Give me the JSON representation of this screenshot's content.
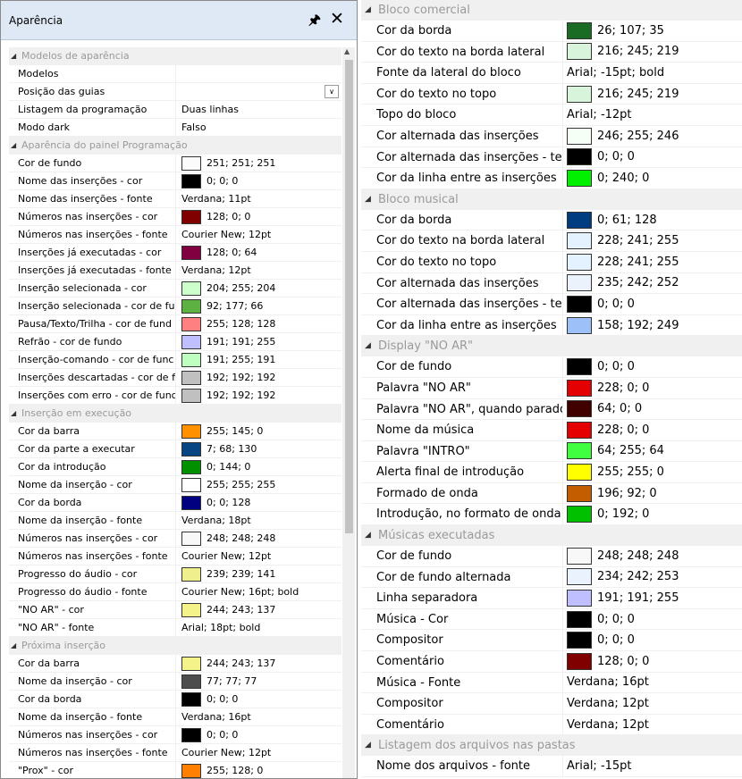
{
  "left_panel": {
    "title": "Aparência",
    "categories": [
      {
        "label": "Modelos de aparência",
        "rows": [
          {
            "name": "Modelos",
            "value": ""
          },
          {
            "name": "Posição das guias",
            "value": "",
            "dropdown": true
          },
          {
            "name": "Listagem da programação",
            "value": "Duas linhas"
          },
          {
            "name": "Modo dark",
            "value": "Falso"
          }
        ]
      },
      {
        "label": "Aparência do painel Programação",
        "rows": [
          {
            "name": "Cor de fundo",
            "color": "#fbfbfb",
            "value": "251; 251; 251"
          },
          {
            "name": "Nome das inserções - cor",
            "color": "#000000",
            "value": "0; 0; 0"
          },
          {
            "name": "Nome das inserções - fonte",
            "value": "Verdana; 11pt"
          },
          {
            "name": "Números nas inserções - cor",
            "color": "#800000",
            "value": "128; 0; 0"
          },
          {
            "name": "Números nas inserções - fonte",
            "value": "Courier New; 12pt"
          },
          {
            "name": "Inserções já executadas - cor",
            "color": "#800040",
            "value": "128; 0; 64"
          },
          {
            "name": "Inserções já executadas - fonte",
            "value": "Verdana; 12pt"
          },
          {
            "name": "Inserção selecionada - cor",
            "color": "#ccffcc",
            "value": "204; 255; 204"
          },
          {
            "name": "Inserção selecionada - cor de fur",
            "color": "#5cb142",
            "value": "92; 177; 66"
          },
          {
            "name": "Pausa/Texto/Trilha - cor de fund",
            "color": "#ff8080",
            "value": "255; 128; 128"
          },
          {
            "name": "Refrão - cor de fundo",
            "color": "#bfbfff",
            "value": "191; 191; 255"
          },
          {
            "name": "Inserção-comando - cor de func",
            "color": "#bfffbf",
            "value": "191; 255; 191"
          },
          {
            "name": "Inserções descartadas - cor de fu",
            "color": "#c0c0c0",
            "value": "192; 192; 192"
          },
          {
            "name": "Inserções com erro - cor de func",
            "color": "#c0c0c0",
            "value": "192; 192; 192"
          }
        ]
      },
      {
        "label": "Inserção em execução",
        "rows": [
          {
            "name": "Cor da barra",
            "color": "#ff9100",
            "value": "255; 145; 0"
          },
          {
            "name": "Cor da parte a executar",
            "color": "#074482",
            "value": "7; 68; 130"
          },
          {
            "name": "Cor da introdução",
            "color": "#009000",
            "value": "0; 144; 0"
          },
          {
            "name": "Nome da inserção - cor",
            "color": "#ffffff",
            "value": "255; 255; 255"
          },
          {
            "name": "Cor da borda",
            "color": "#000080",
            "value": "0; 0; 128"
          },
          {
            "name": "Nome da inserção - fonte",
            "value": "Verdana; 18pt"
          },
          {
            "name": "Números nas inserções - cor",
            "color": "#f8f8f8",
            "value": "248; 248; 248"
          },
          {
            "name": "Números nas inserções - fonte",
            "value": "Courier New; 12pt"
          },
          {
            "name": "Progresso do áudio - cor",
            "color": "#efef8d",
            "value": "239; 239; 141"
          },
          {
            "name": "Progresso do áudio - fonte",
            "value": "Courier New; 16pt; bold"
          },
          {
            "name": "\"NO AR\" - cor",
            "color": "#f4f389",
            "value": "244; 243; 137"
          },
          {
            "name": "\"NO AR\" - fonte",
            "value": "Arial; 18pt; bold"
          }
        ]
      },
      {
        "label": "Próxima inserção",
        "rows": [
          {
            "name": "Cor da barra",
            "color": "#f4f389",
            "value": "244; 243; 137"
          },
          {
            "name": "Nome da inserção - cor",
            "color": "#4d4d4d",
            "value": "77; 77; 77"
          },
          {
            "name": "Cor da borda",
            "color": "#000000",
            "value": "0; 0; 0"
          },
          {
            "name": "Nome da inserção - fonte",
            "value": "Verdana; 16pt"
          },
          {
            "name": "Números nas inserções - cor",
            "color": "#000000",
            "value": "0; 0; 0"
          },
          {
            "name": "Números nas inserções - fonte",
            "value": "Courier New; 12pt"
          },
          {
            "name": "\"Prox\" - cor",
            "color": "#ff8000",
            "value": "255; 128; 0"
          },
          {
            "name": "\"Prox\" - fonte",
            "value": "Arial; 16pt; bold"
          }
        ]
      }
    ]
  },
  "right_panel": {
    "categories": [
      {
        "label": "Bloco comercial",
        "rows": [
          {
            "name": "Cor da borda",
            "color": "#1a6b23",
            "value": "26; 107; 35"
          },
          {
            "name": "Cor do texto na borda lateral",
            "color": "#d8f5db",
            "value": "216; 245; 219"
          },
          {
            "name": "Fonte da lateral do bloco",
            "value": "Arial; -15pt; bold"
          },
          {
            "name": "Cor do texto no topo",
            "color": "#d8f5db",
            "value": "216; 245; 219"
          },
          {
            "name": "Topo do bloco",
            "value": "Arial; -12pt"
          },
          {
            "name": "Cor alternada das inserções",
            "color": "#f6fff6",
            "value": "246; 255; 246"
          },
          {
            "name": "Cor alternada das inserções - tex",
            "color": "#000000",
            "value": "0; 0; 0"
          },
          {
            "name": "Cor da linha entre as inserções",
            "color": "#00f000",
            "value": "0; 240; 0"
          }
        ]
      },
      {
        "label": "Bloco musical",
        "rows": [
          {
            "name": "Cor da borda",
            "color": "#003d80",
            "value": "0; 61; 128"
          },
          {
            "name": "Cor do texto na borda lateral",
            "color": "#e4f1ff",
            "value": "228; 241; 255"
          },
          {
            "name": "Cor do texto no topo",
            "color": "#e4f1ff",
            "value": "228; 241; 255"
          },
          {
            "name": "Cor alternada das inserções",
            "color": "#ebf2fc",
            "value": "235; 242; 252"
          },
          {
            "name": "Cor alternada das inserções - tex",
            "color": "#000000",
            "value": "0; 0; 0"
          },
          {
            "name": "Cor da linha entre as inserções",
            "color": "#9ec0f9",
            "value": "158; 192; 249"
          }
        ]
      },
      {
        "label": "Display \"NO AR\"",
        "rows": [
          {
            "name": "Cor de fundo",
            "color": "#000000",
            "value": "0; 0; 0"
          },
          {
            "name": "Palavra \"NO AR\"",
            "color": "#e40000",
            "value": "228; 0; 0"
          },
          {
            "name": "Palavra \"NO AR\", quando parado",
            "color": "#400000",
            "value": "64; 0; 0"
          },
          {
            "name": "Nome da música",
            "color": "#e40000",
            "value": "228; 0; 0"
          },
          {
            "name": "Palavra \"INTRO\"",
            "color": "#40ff40",
            "value": "64; 255; 64"
          },
          {
            "name": "Alerta final de introdução",
            "color": "#ffff00",
            "value": "255; 255; 0"
          },
          {
            "name": "Formado de onda",
            "color": "#c45c00",
            "value": "196; 92; 0"
          },
          {
            "name": "Introdução, no formato de onda",
            "color": "#00c000",
            "value": "0; 192; 0"
          }
        ]
      },
      {
        "label": "Músicas executadas",
        "rows": [
          {
            "name": "Cor de fundo",
            "color": "#f8f8f8",
            "value": "248; 248; 248"
          },
          {
            "name": "Cor de fundo alternada",
            "color": "#eaf2fd",
            "value": "234; 242; 253"
          },
          {
            "name": "Linha separadora",
            "color": "#bfbfff",
            "value": "191; 191; 255"
          },
          {
            "name": "Música - Cor",
            "color": "#000000",
            "value": "0; 0; 0"
          },
          {
            "name": "Compositor",
            "color": "#000000",
            "value": "0; 0; 0"
          },
          {
            "name": "Comentário",
            "color": "#800000",
            "value": "128; 0; 0"
          },
          {
            "name": "Música - Fonte",
            "value": "Verdana; 16pt"
          },
          {
            "name": "Compositor",
            "value": "Verdana; 12pt"
          },
          {
            "name": "Comentário",
            "value": "Verdana; 12pt"
          }
        ]
      },
      {
        "label": "Listagem dos arquivos nas pastas",
        "rows": [
          {
            "name": "Nome dos arquivos - fonte",
            "value": "Arial; -15pt"
          }
        ]
      }
    ]
  }
}
